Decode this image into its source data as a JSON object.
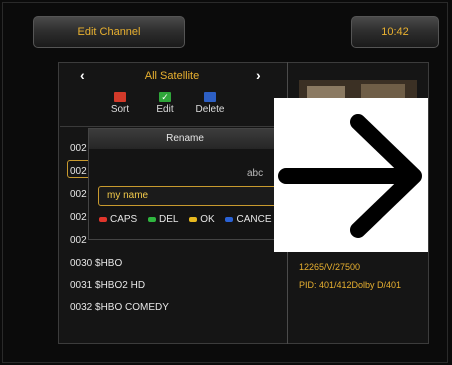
{
  "header": {
    "title": "Edit Channel",
    "clock": "10:42"
  },
  "nav": {
    "title": "All Satellite",
    "left_arrow": "‹",
    "right_arrow": "›"
  },
  "toolbar": {
    "sort_label": "Sort",
    "edit_label": "Edit",
    "delete_label": "Delete",
    "colors": {
      "sort": "#d23a2a",
      "edit": "#2fa63a",
      "delete": "#2d5fc4"
    }
  },
  "channels": [
    {
      "text": "002"
    },
    {
      "text": "002"
    },
    {
      "text": "002"
    },
    {
      "text": "002"
    },
    {
      "text": "002"
    },
    {
      "text": "0030 $HBO"
    },
    {
      "text": "0031 $HBO2 HD"
    },
    {
      "text": "0032 $HBO COMEDY"
    }
  ],
  "rename_dialog": {
    "title": "Rename",
    "mode": "abc",
    "value": "my name",
    "hints": [
      {
        "label": "CAPS",
        "color": "#e0352b"
      },
      {
        "label": "DEL",
        "color": "#2fb63f"
      },
      {
        "label": "OK",
        "color": "#e8b91f"
      },
      {
        "label": "CANCE",
        "color": "#2a62d6"
      }
    ]
  },
  "info": {
    "transponder": "12265/V/27500",
    "pid": "PID: 401/412Dolby D/401"
  },
  "overlay": {
    "icon": "arrow-right-icon"
  }
}
